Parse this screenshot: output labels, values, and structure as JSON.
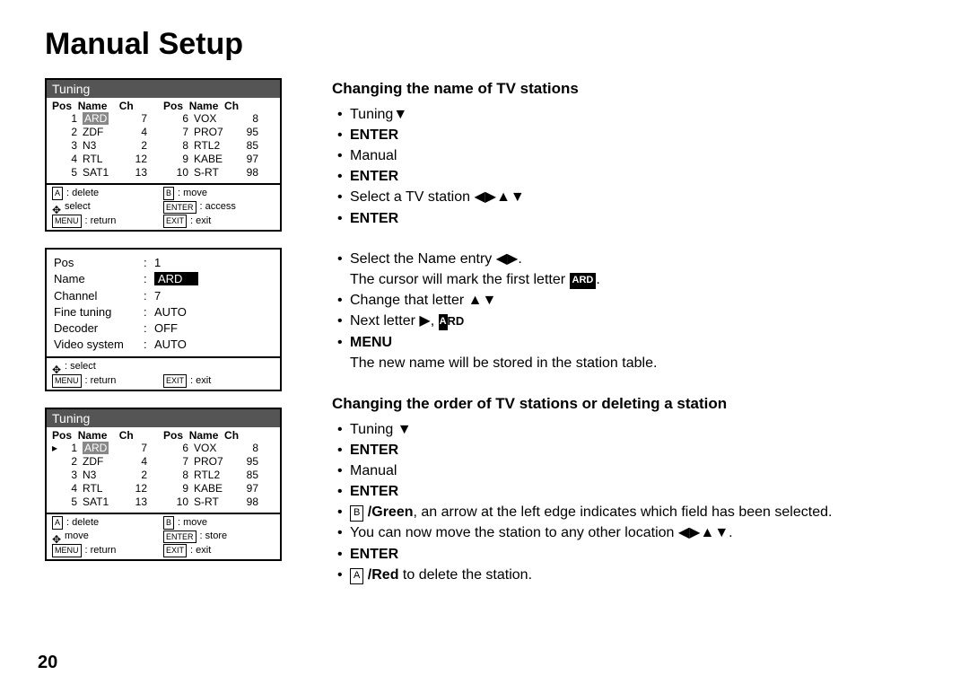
{
  "pageNumber": "20",
  "title": "Manual Setup",
  "panelTitle": "Tuning",
  "colHdr": {
    "pos": "Pos",
    "name": "Name",
    "ch": "Ch"
  },
  "stationsLeft": [
    {
      "pos": "1",
      "name": "ARD",
      "ch": "7"
    },
    {
      "pos": "2",
      "name": "ZDF",
      "ch": "4"
    },
    {
      "pos": "3",
      "name": "N3",
      "ch": "2"
    },
    {
      "pos": "4",
      "name": "RTL",
      "ch": "12"
    },
    {
      "pos": "5",
      "name": "SAT1",
      "ch": "13"
    }
  ],
  "stationsRight": [
    {
      "pos": "6",
      "name": "VOX",
      "ch": "8"
    },
    {
      "pos": "7",
      "name": "PRO7",
      "ch": "95"
    },
    {
      "pos": "8",
      "name": "RTL2",
      "ch": "85"
    },
    {
      "pos": "9",
      "name": "KABE",
      "ch": "97"
    },
    {
      "pos": "10",
      "name": "S-RT",
      "ch": "98"
    }
  ],
  "hints1": {
    "aDelete": "delete",
    "bMove": "move",
    "select": "select",
    "enterAccess": "access",
    "menuReturn": "return",
    "exitExit": "exit"
  },
  "hints3": {
    "aDelete": "delete",
    "bMove": "move",
    "move": "move",
    "enterStore": "store",
    "menuReturn": "return",
    "exitExit": "exit"
  },
  "form": {
    "posLabel": "Pos",
    "posVal": "1",
    "nameLabel": "Name",
    "nameVal": "ARD",
    "channelLabel": "Channel",
    "channelVal": "7",
    "fineLabel": "Fine tuning",
    "fineVal": "AUTO",
    "decoderLabel": "Decoder",
    "decoderVal": "OFF",
    "videoLabel": "Video system",
    "videoVal": "AUTO"
  },
  "hints2": {
    "select": "select",
    "menuReturn": "return",
    "exitExit": "exit"
  },
  "sec1": {
    "heading": "Changing the name of TV stations",
    "li1": "Tuning",
    "enter": "ENTER",
    "manual": "Manual",
    "selectStation": "Select a TV station",
    "selectName": "Select the Name entry",
    "cursorMark": "The cursor will mark the first letter",
    "changeLetter": "Change that letter",
    "nextLetter": "Next letter",
    "menu": "MENU",
    "stored": "The new name will be stored in the station table."
  },
  "sec2": {
    "heading": "Changing the order of TV stations or deleting a station",
    "tuning": "Tuning",
    "enter": "ENTER",
    "manual": "Manual",
    "greenText": "/Green",
    "greenTail": ", an arrow at the left edge indicates which field has been selected.",
    "moveText": "You can now move the station to any other location",
    "redText": "/Red",
    "redTail": " to delete the station."
  },
  "glyph": {
    "A": "A",
    "B": "B",
    "ENTER": "ENTER",
    "MENU": "MENU",
    "EXIT": "EXIT",
    "ARD": "ARD",
    "ARD2": "ARD"
  }
}
